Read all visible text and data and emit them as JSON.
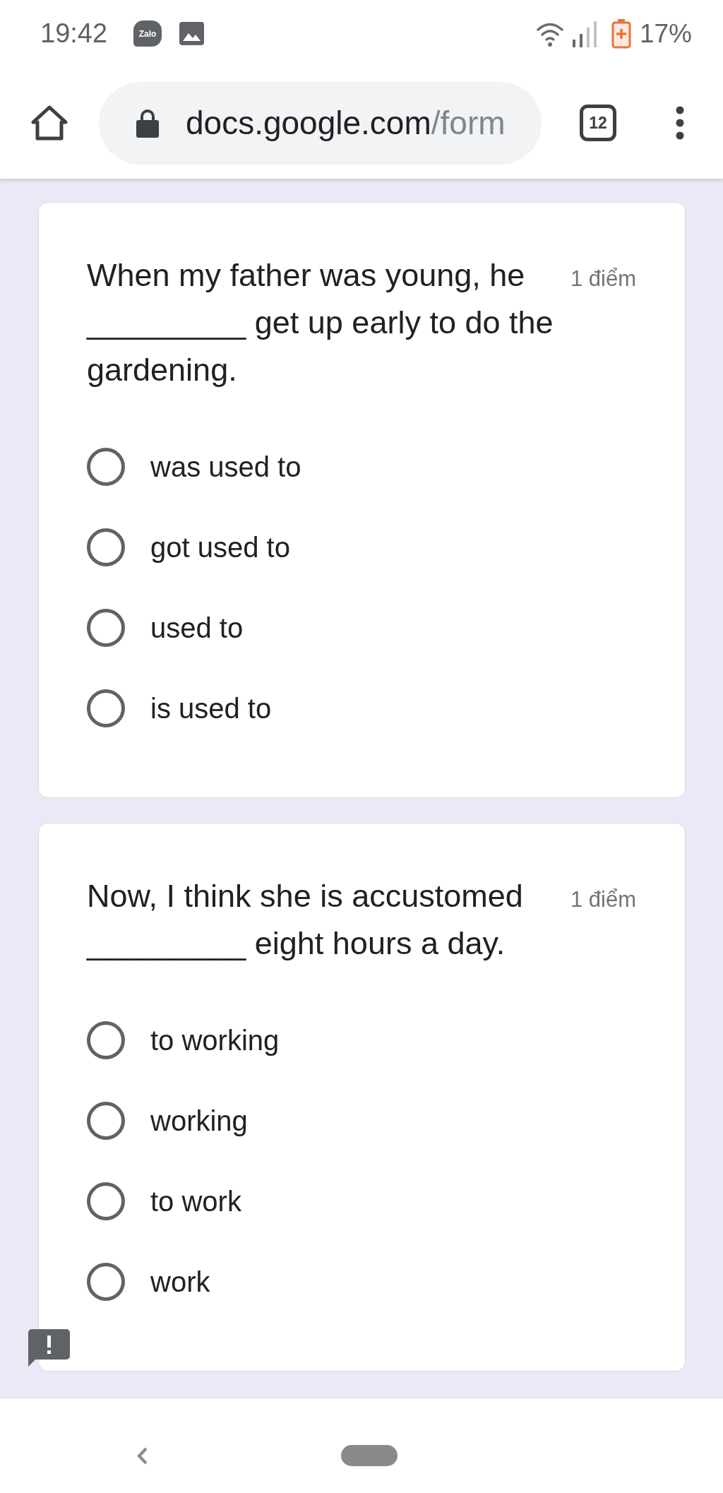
{
  "status_bar": {
    "time": "19:42",
    "notifications": [
      {
        "kind": "app",
        "label": "Zalo"
      },
      {
        "kind": "image"
      }
    ],
    "battery": "17%"
  },
  "browser": {
    "url": {
      "host": "docs.google.com",
      "path": "/form"
    },
    "tab_count": "12"
  },
  "questions": [
    {
      "text": "When my father was young, he _________ get up early to do the gardening.",
      "points": "1 điểm",
      "options": [
        {
          "label": "was used to",
          "selected": false
        },
        {
          "label": "got used to",
          "selected": false
        },
        {
          "label": "used to",
          "selected": false
        },
        {
          "label": "is used to",
          "selected": false
        }
      ]
    },
    {
      "text": "Now, I think she is accustomed _________ eight hours a day.",
      "points": "1 điểm",
      "options": [
        {
          "label": "to working",
          "selected": false
        },
        {
          "label": "working",
          "selected": false
        },
        {
          "label": "to work",
          "selected": false
        },
        {
          "label": "work",
          "selected": false
        }
      ]
    }
  ]
}
